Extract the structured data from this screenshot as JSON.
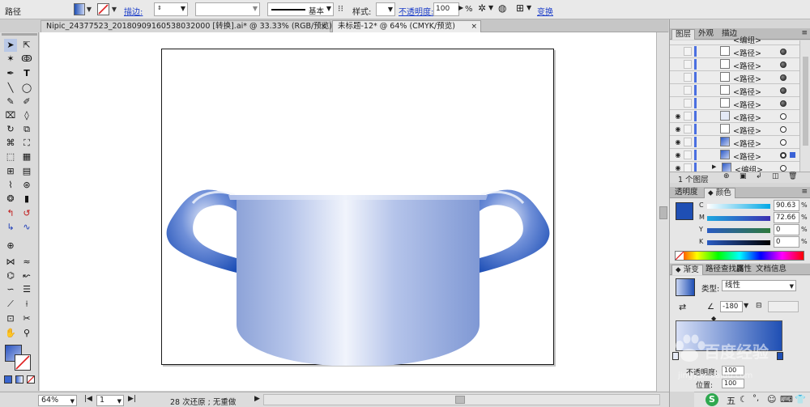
{
  "control_bar": {
    "object_type": "路径",
    "stroke_label": "描边:",
    "stroke_profile": "基本",
    "style_label": "样式:",
    "opacity_label": "不透明度:",
    "opacity_value": "100",
    "opacity_unit": "%",
    "transform_link": "变换"
  },
  "document_tabs": [
    {
      "label": "Nipic_24377523_20180909160538032000 [转换].ai* @ 33.33% (RGB/预览)",
      "close": "×"
    },
    {
      "label": "未标题-12* @ 64% (CMYK/预览)",
      "close": "×"
    }
  ],
  "status_bar": {
    "zoom": "64%",
    "artboard": "1",
    "status_text": "28 次还原 ; 无重做"
  },
  "layers_panel": {
    "tabs": [
      "图层",
      "外观",
      "描边"
    ],
    "rows": [
      {
        "name": "<编组>",
        "visible": false,
        "expand": ""
      },
      {
        "name": "<路径>",
        "visible": false,
        "expand": ""
      },
      {
        "name": "<路径>",
        "visible": false,
        "expand": ""
      },
      {
        "name": "<路径>",
        "visible": false,
        "expand": ""
      },
      {
        "name": "<路径>",
        "visible": false,
        "expand": ""
      },
      {
        "name": "<路径>",
        "visible": false,
        "expand": ""
      },
      {
        "name": "<路径>",
        "visible": true,
        "expand": ""
      },
      {
        "name": "<路径>",
        "visible": true,
        "expand": ""
      },
      {
        "name": "<路径>",
        "visible": true,
        "expand": ""
      },
      {
        "name": "<路径>",
        "visible": true,
        "expand": ""
      },
      {
        "name": "<编组>",
        "visible": true,
        "expand": "▶"
      }
    ],
    "footer_count": "1 个图层"
  },
  "color_panel": {
    "tabs": [
      "透明度",
      "颜色"
    ],
    "channels": [
      {
        "label": "C",
        "value": "90.63",
        "unit": "%"
      },
      {
        "label": "M",
        "value": "72.66",
        "unit": "%"
      },
      {
        "label": "Y",
        "value": "0",
        "unit": "%"
      },
      {
        "label": "K",
        "value": "0",
        "unit": "%"
      }
    ]
  },
  "gradient_panel": {
    "tabs": [
      "渐变",
      "路径查找器",
      "属性",
      "文档信息"
    ],
    "type_label": "类型:",
    "type_value": "线性",
    "angle": "-180",
    "opacity_label": "不透明度:",
    "opacity_value": "100",
    "location_label": "位置:",
    "location_value": "100"
  },
  "watermark": {
    "text": "百度经验",
    "domain": "jingyan.baidu.com"
  },
  "taskbar": {
    "ime_label": "五"
  },
  "colors": {
    "accent_blue": "#2e55b8",
    "fill_start": "#1f4fb4",
    "fill_end": "#dde4f7"
  }
}
